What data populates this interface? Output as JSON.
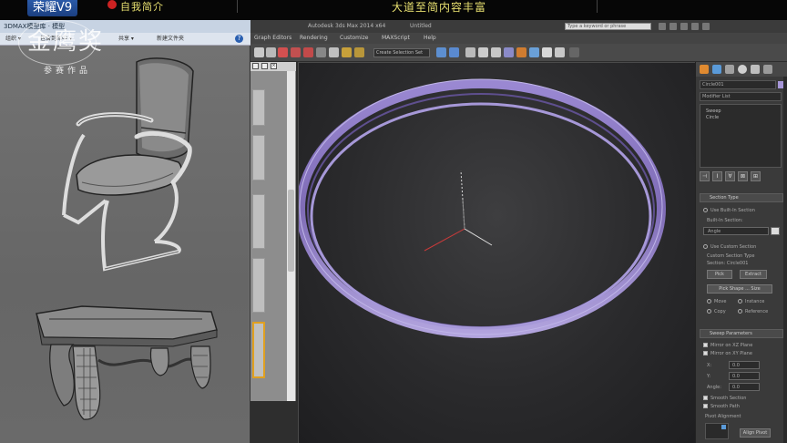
{
  "banner": {
    "logo": "荣耀V9",
    "mid_text": "自我简介",
    "right_text": "大道至简内容丰富"
  },
  "watermark": {
    "big_text": "金鹰奖",
    "small_text": "参赛作品"
  },
  "explorer": {
    "title": "3DMAX模型库 · 模型",
    "menu": [
      "组织 ▾",
      "包含到库中 ▾",
      "共享 ▾",
      "新建文件夹"
    ]
  },
  "max": {
    "app_title": "Autodesk 3ds Max 2014 x64",
    "doc_title": "Untitled",
    "search_placeholder": "Type a keyword or phrase",
    "menu": [
      "Graph Editors",
      "Rendering",
      "Customize",
      "MAXScript",
      "Help"
    ],
    "selection_set": "Create Selection Set"
  },
  "command_panel": {
    "object_name": "Circle001",
    "modifier_list": "Modifier List",
    "stack": [
      "Sweep",
      "Circle"
    ],
    "stack_buttons": [
      "⊣",
      "I",
      "∀",
      "⊠",
      "⊞"
    ],
    "section_type_title": "Section Type",
    "use_builtin": "Use Built-In Section",
    "builtin_section_label": "Built-In Section:",
    "builtin_section_value": "Angle",
    "use_custom": "Use Custom Section",
    "custom_section_type": "Custom Section Type",
    "section": "Section: Circle001",
    "pick": "Pick",
    "extract": "Extract",
    "pick_shape": "Pick Shape ... Size",
    "move": "Move",
    "instance": "Instance",
    "copy": "Copy",
    "reference": "Reference",
    "interpolation_title": "Sweep Parameters",
    "mirror_xz": "Mirror on XZ Plane",
    "mirror_xy": "Mirror on XY Plane",
    "x_label": "X:",
    "x_value": "0.0",
    "y_label": "Y:",
    "y_value": "0.0",
    "angle_label": "Angle:",
    "angle_value": "0.0",
    "smooth_section": "Smooth Section",
    "smooth_path": "Smooth Path",
    "pivot_alignment": "Pivot Alignment",
    "align_pivot": "Align Pivot"
  },
  "colors": {
    "ring": "#8a78c2",
    "ring_edge": "#b4a8e0",
    "accent": "#e0a020"
  }
}
